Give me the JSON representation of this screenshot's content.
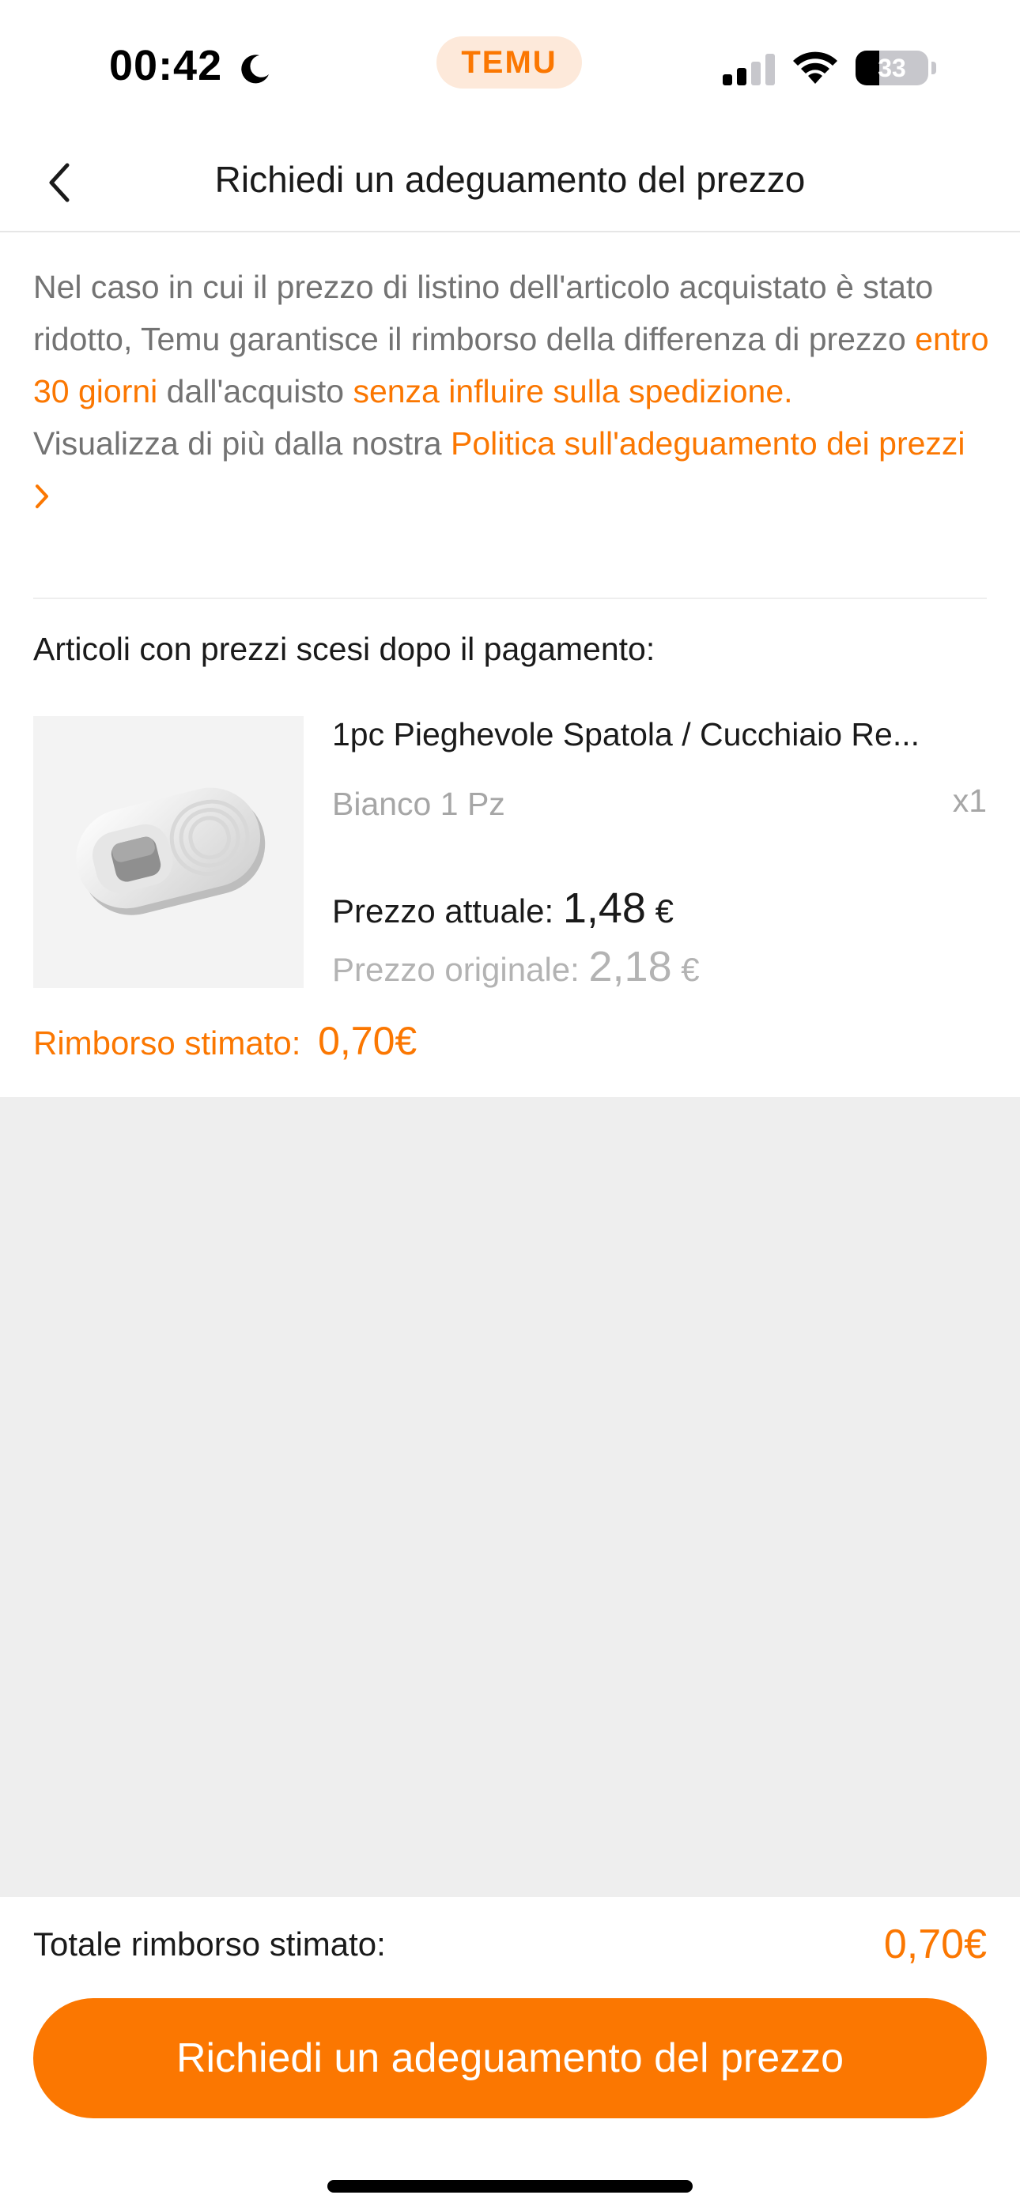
{
  "status_bar": {
    "time": "00:42",
    "dynamic_island_label": "TEMU",
    "battery": "33"
  },
  "header": {
    "title": "Richiedi un adeguamento del prezzo"
  },
  "intro": {
    "text_1": "Nel caso in cui il prezzo di listino dell'articolo acquistato è stato ridotto, Temu garantisce il rimborso della differenza di prezzo ",
    "highlight_1": "entro 30 giorni",
    "text_2": " dall'acquisto ",
    "highlight_2": "senza influire sulla spedizione.",
    "text_3": "Visualizza di più dalla nostra ",
    "policy_link": "Politica sull'adeguamento dei prezzi"
  },
  "section_label": "Articoli con prezzi scesi dopo il pagamento:",
  "item": {
    "title": "1pc Pieghevole Spatola / Cucchiaio Re...",
    "variant": "Bianco 1 Pz",
    "quantity": "x1",
    "current_price_label": "Prezzo attuale:",
    "current_price_value": "1,48",
    "current_price_currency": "€",
    "original_price_label": "Prezzo originale:",
    "original_price_value": "2,18",
    "original_price_currency": "€"
  },
  "refund": {
    "label": "Rimborso stimato:",
    "value": "0,70€"
  },
  "footer": {
    "total_label": "Totale rimborso stimato:",
    "total_value": "0,70€",
    "cta_label": "Richiedi un adeguamento del prezzo"
  },
  "colors": {
    "accent": "#fb7701",
    "background_gray": "#eeeeee",
    "muted_text": "#737373"
  },
  "icons": [
    "moon-icon",
    "signal-icon",
    "wifi-icon",
    "battery-icon",
    "back-chevron-icon",
    "chevron-right-icon"
  ]
}
